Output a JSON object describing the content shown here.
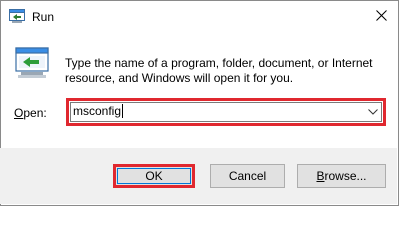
{
  "window": {
    "title": "Run",
    "close_symbol": "✕"
  },
  "icons": {
    "title_icon": "run-icon",
    "big_icon": "run-icon",
    "close_icon": "close-icon",
    "dropdown_icon": "chevron-down-icon"
  },
  "body": {
    "description": "Type the name of a program, folder, document, or Internet resource, and Windows will open it for you."
  },
  "open_field": {
    "label_hotkey": "O",
    "label_rest": "pen:",
    "value": "msconfig"
  },
  "buttons": {
    "ok_label": "OK",
    "cancel_label": "Cancel",
    "browse_hotkey": "B",
    "browse_rest": "rowse..."
  },
  "colors": {
    "highlight": "#e0282f",
    "focus": "#0078d7",
    "footer_bg": "#f0f0f0",
    "button_bg": "#e1e1e1"
  }
}
